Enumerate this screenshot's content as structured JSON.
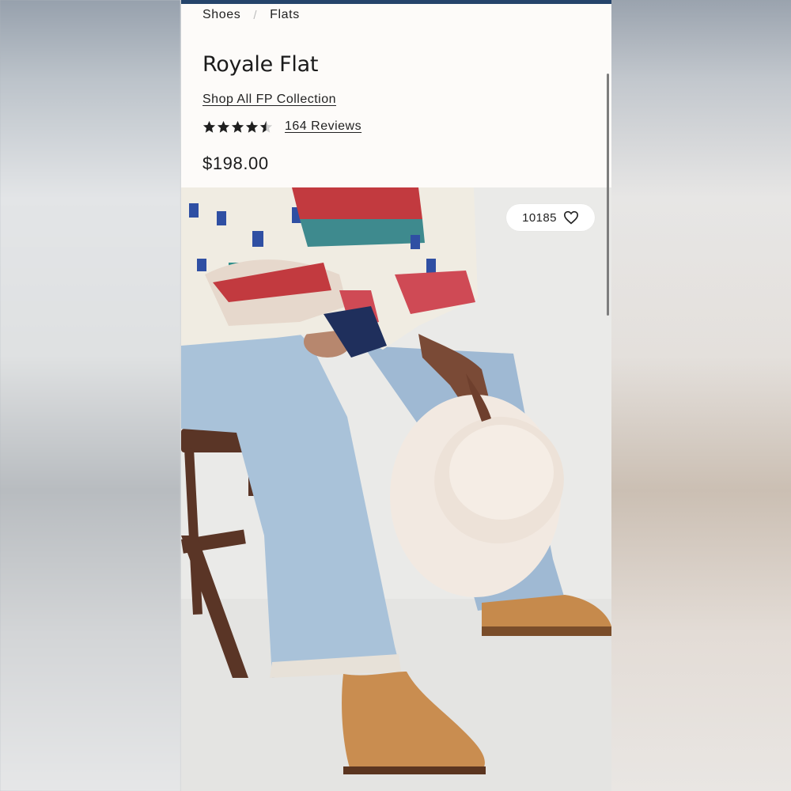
{
  "breadcrumb": [
    "Shoes",
    "Flats"
  ],
  "product": {
    "title": "Royale Flat",
    "collection_link": "Shop All FP Collection",
    "rating": 4.5,
    "reviews_label": "164 Reviews",
    "price": "$198.00"
  },
  "favorites": {
    "count": "10185",
    "icon": "heart-icon"
  },
  "colors": {
    "top_bar": "#25446b",
    "page_bg": "#fdfbf9"
  }
}
